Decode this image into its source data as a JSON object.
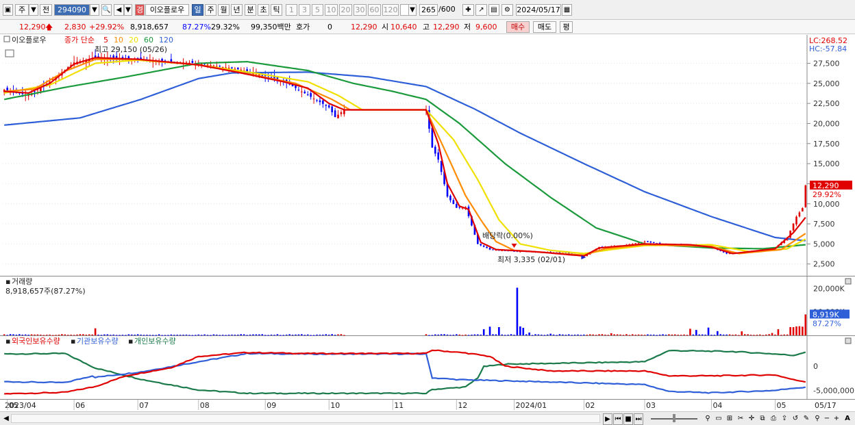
{
  "toolbar": {
    "market_label": "주",
    "prev_label": "전",
    "stock_code": "294090",
    "stock_name": "이오플로우",
    "stock_badge": "경",
    "periods": [
      "일",
      "주",
      "월",
      "년",
      "분",
      "초",
      "틱"
    ],
    "selected_period": "일",
    "intervals": [
      "1",
      "3",
      "5",
      "10",
      "20",
      "30",
      "60",
      "120"
    ],
    "count_value": "265",
    "count_total": "/600",
    "date_value": "2024/05/17"
  },
  "quote": {
    "price": "12,290",
    "change": "2,830",
    "change_pct": "+29.92%",
    "volume": "8,918,657",
    "volume_ratio": "87.27%",
    "turnover_ratio": "29.32%",
    "trade_value": "99,350백만",
    "hoga_label": "호가",
    "hoga_value": "0",
    "hoga_price": "12,290",
    "open_label": "시",
    "open_value": "10,640",
    "high_label": "고",
    "high_value": "12,290",
    "low_label": "저",
    "low_value": "9,600",
    "buy_label": "매수",
    "sell_label": "매도",
    "eval_label": "평"
  },
  "colors": {
    "up": "#e00000",
    "down": "#0000ff",
    "ma5": "#e00000",
    "ma10": "#ff8c00",
    "ma20": "#f0e000",
    "ma60": "#1a9a3a",
    "ma120": "#2e5fd8",
    "foreign": "#e00000",
    "institution": "#2e5fd8",
    "individual": "#1a7a4a"
  },
  "chart_data": {
    "type": "line",
    "price_panel": {
      "stock_name": "이오플로우",
      "ma_label": "종가 단순",
      "ma_periods": [
        "5",
        "10",
        "20",
        "60",
        "120"
      ],
      "high_annotation": "최고 29,150 (05/26)",
      "low_annotation": "최저 3,335 (02/01)",
      "dividend_annotation": "배당락(0.00%)",
      "lc": "LC:268.52",
      "hc": "HC:-57.84",
      "y_ticks": [
        27500,
        25000,
        22500,
        20000,
        17500,
        15000,
        12500,
        10000,
        7500,
        5000,
        2500
      ],
      "y_tick_labels": [
        "27,500",
        "25,000",
        "22,500",
        "20,000",
        "17,500",
        "15,000",
        "12,500",
        "10,000",
        "7,500",
        "5,000",
        "2,500"
      ],
      "current_price_label": "12,290",
      "current_pct_label": "29.92%",
      "ylim": [
        1200,
        29500
      ],
      "x_months": [
        "2023/04",
        "05",
        "06",
        "07",
        "08",
        "09",
        "10",
        "11",
        "12",
        "2024/01",
        "02",
        "03",
        "04",
        "05",
        "05/17"
      ],
      "month_index": [
        0,
        1,
        23,
        44,
        64,
        86,
        107,
        128,
        149,
        168,
        191,
        211,
        233,
        254,
        264
      ],
      "close_keypoints": [
        [
          0,
          24200
        ],
        [
          8,
          23500
        ],
        [
          15,
          25200
        ],
        [
          23,
          27600
        ],
        [
          30,
          28200
        ],
        [
          44,
          28000
        ],
        [
          64,
          27500
        ],
        [
          78,
          26700
        ],
        [
          92,
          25300
        ],
        [
          107,
          22000
        ],
        [
          109,
          20800
        ],
        [
          112,
          21700
        ],
        [
          139,
          21700
        ],
        [
          141,
          17000
        ],
        [
          143,
          15500
        ],
        [
          146,
          10900
        ],
        [
          149,
          9500
        ],
        [
          152,
          9600
        ],
        [
          156,
          5000
        ],
        [
          160,
          4300
        ],
        [
          168,
          4100
        ],
        [
          176,
          4000
        ],
        [
          184,
          3900
        ],
        [
          191,
          3500
        ],
        [
          196,
          4600
        ],
        [
          204,
          4800
        ],
        [
          211,
          5300
        ],
        [
          218,
          4900
        ],
        [
          226,
          4900
        ],
        [
          233,
          4600
        ],
        [
          238,
          3800
        ],
        [
          246,
          4000
        ],
        [
          254,
          4500
        ],
        [
          258,
          5800
        ],
        [
          261,
          8400
        ],
        [
          263,
          9460
        ],
        [
          264,
          12290
        ]
      ],
      "ma5_keypoints": [
        [
          0,
          24000
        ],
        [
          8,
          23800
        ],
        [
          15,
          25000
        ],
        [
          23,
          27400
        ],
        [
          30,
          28200
        ],
        [
          44,
          28000
        ],
        [
          64,
          27300
        ],
        [
          78,
          26300
        ],
        [
          92,
          25200
        ],
        [
          100,
          24400
        ],
        [
          107,
          22500
        ],
        [
          112,
          21700
        ],
        [
          139,
          21700
        ],
        [
          143,
          17500
        ],
        [
          146,
          12500
        ],
        [
          150,
          9700
        ],
        [
          153,
          9300
        ],
        [
          157,
          5200
        ],
        [
          162,
          4300
        ],
        [
          176,
          4000
        ],
        [
          191,
          3500
        ],
        [
          196,
          4500
        ],
        [
          211,
          5000
        ],
        [
          226,
          4900
        ],
        [
          233,
          4600
        ],
        [
          240,
          3800
        ],
        [
          254,
          4400
        ],
        [
          260,
          6400
        ],
        [
          264,
          8300
        ]
      ],
      "ma10_keypoints": [
        [
          0,
          24000
        ],
        [
          10,
          24300
        ],
        [
          20,
          26500
        ],
        [
          30,
          28000
        ],
        [
          44,
          28000
        ],
        [
          64,
          27300
        ],
        [
          80,
          26200
        ],
        [
          96,
          25000
        ],
        [
          108,
          23000
        ],
        [
          114,
          21700
        ],
        [
          139,
          21700
        ],
        [
          146,
          16000
        ],
        [
          152,
          11000
        ],
        [
          157,
          8000
        ],
        [
          162,
          5300
        ],
        [
          168,
          4200
        ],
        [
          191,
          3600
        ],
        [
          198,
          4400
        ],
        [
          211,
          4900
        ],
        [
          233,
          4700
        ],
        [
          242,
          3800
        ],
        [
          256,
          4300
        ],
        [
          264,
          6300
        ]
      ],
      "ma20_keypoints": [
        [
          0,
          23800
        ],
        [
          15,
          24800
        ],
        [
          30,
          27500
        ],
        [
          44,
          27900
        ],
        [
          64,
          27300
        ],
        [
          84,
          26200
        ],
        [
          100,
          25200
        ],
        [
          110,
          23500
        ],
        [
          118,
          21700
        ],
        [
          139,
          21700
        ],
        [
          148,
          18000
        ],
        [
          156,
          13000
        ],
        [
          163,
          8000
        ],
        [
          170,
          5000
        ],
        [
          180,
          4200
        ],
        [
          191,
          3800
        ],
        [
          200,
          4300
        ],
        [
          211,
          4800
        ],
        [
          233,
          4900
        ],
        [
          246,
          4000
        ],
        [
          258,
          4400
        ],
        [
          264,
          5600
        ]
      ],
      "ma60_keypoints": [
        [
          0,
          23000
        ],
        [
          20,
          24500
        ],
        [
          40,
          25800
        ],
        [
          64,
          27500
        ],
        [
          80,
          27700
        ],
        [
          100,
          26600
        ],
        [
          115,
          25000
        ],
        [
          128,
          24000
        ],
        [
          139,
          23000
        ],
        [
          150,
          20000
        ],
        [
          165,
          15000
        ],
        [
          180,
          10800
        ],
        [
          195,
          7000
        ],
        [
          211,
          5000
        ],
        [
          233,
          4500
        ],
        [
          250,
          4400
        ],
        [
          264,
          4900
        ]
      ],
      "ma120_keypoints": [
        [
          0,
          19800
        ],
        [
          25,
          20700
        ],
        [
          45,
          23000
        ],
        [
          64,
          25600
        ],
        [
          75,
          26300
        ],
        [
          100,
          26400
        ],
        [
          120,
          25800
        ],
        [
          139,
          24600
        ],
        [
          155,
          21800
        ],
        [
          170,
          18800
        ],
        [
          191,
          15000
        ],
        [
          211,
          11500
        ],
        [
          233,
          8400
        ],
        [
          254,
          5800
        ],
        [
          264,
          5400
        ]
      ]
    },
    "volume_panel": {
      "title": "거래량",
      "current_value_label": "8,918,657주(87.27%)",
      "y_tick_labels": [
        "20,000K",
        "10,000K"
      ],
      "y_ticks": [
        20000,
        10000
      ],
      "current_tag": "8,919K",
      "current_pct_tag": "87.27%",
      "ylim": [
        0,
        21000
      ],
      "spikes": [
        [
          30,
          3000
        ],
        [
          158,
          2600
        ],
        [
          160,
          3700
        ],
        [
          163,
          3500
        ],
        [
          169,
          20300
        ],
        [
          170,
          3800
        ],
        [
          171,
          3200
        ],
        [
          173,
          1200
        ],
        [
          180,
          700
        ],
        [
          200,
          900
        ],
        [
          226,
          2800
        ],
        [
          228,
          2300
        ],
        [
          232,
          3300
        ],
        [
          235,
          1800
        ],
        [
          243,
          1700
        ],
        [
          253,
          1000
        ],
        [
          255,
          2600
        ],
        [
          259,
          3500
        ],
        [
          260,
          3500
        ],
        [
          261,
          3800
        ],
        [
          262,
          3900
        ],
        [
          263,
          3700
        ],
        [
          264,
          8919
        ]
      ]
    },
    "holdings_panel": {
      "series_labels": [
        "외국인보유수량",
        "기관보유수량",
        "개인보유수량"
      ],
      "y_tick_labels": [
        "0",
        "-5,000,000"
      ],
      "y_ticks": [
        0,
        -5000000
      ],
      "ylim": [
        -6200000,
        4500000
      ],
      "foreign_keypoints": [
        [
          0,
          -5700000
        ],
        [
          20,
          -5400000
        ],
        [
          30,
          -4200000
        ],
        [
          40,
          -2000000
        ],
        [
          55,
          -300000
        ],
        [
          64,
          2000000
        ],
        [
          80,
          2800000
        ],
        [
          100,
          2600000
        ],
        [
          139,
          2600000
        ],
        [
          141,
          3300000
        ],
        [
          152,
          2700000
        ],
        [
          160,
          2000000
        ],
        [
          165,
          0
        ],
        [
          180,
          -1000000
        ],
        [
          211,
          -1000000
        ],
        [
          219,
          -2000000
        ],
        [
          233,
          -2000000
        ],
        [
          254,
          -1800000
        ],
        [
          260,
          -2800000
        ],
        [
          264,
          -3200000
        ]
      ],
      "institution_keypoints": [
        [
          0,
          -3200000
        ],
        [
          20,
          -3400000
        ],
        [
          29,
          -2000000
        ],
        [
          30,
          -2300000
        ],
        [
          45,
          -1200000
        ],
        [
          64,
          900000
        ],
        [
          80,
          2600000
        ],
        [
          100,
          2500000
        ],
        [
          139,
          2500000
        ],
        [
          141,
          -2400000
        ],
        [
          150,
          -2800000
        ],
        [
          170,
          -3100000
        ],
        [
          211,
          -3800000
        ],
        [
          219,
          -5200000
        ],
        [
          233,
          -5500000
        ],
        [
          254,
          -5000000
        ],
        [
          260,
          -4500000
        ],
        [
          264,
          -4400000
        ]
      ],
      "individual_keypoints": [
        [
          0,
          2500000
        ],
        [
          20,
          2600000
        ],
        [
          30,
          -400000
        ],
        [
          45,
          -2700000
        ],
        [
          64,
          -4900000
        ],
        [
          80,
          -5600000
        ],
        [
          100,
          -5600000
        ],
        [
          139,
          -5600000
        ],
        [
          141,
          -4800000
        ],
        [
          152,
          -4300000
        ],
        [
          156,
          -2400000
        ],
        [
          158,
          -100000
        ],
        [
          165,
          400000
        ],
        [
          211,
          900000
        ],
        [
          219,
          3200000
        ],
        [
          240,
          3000000
        ],
        [
          254,
          2500000
        ],
        [
          260,
          2200000
        ],
        [
          264,
          2900000
        ]
      ]
    }
  },
  "scrollbar": {
    "left_arrow": "◀",
    "play": "▶",
    "rewind": "⏮",
    "stop": "■",
    "forward": "⏭",
    "minus": "−",
    "plus": "+",
    "auto": "A"
  }
}
